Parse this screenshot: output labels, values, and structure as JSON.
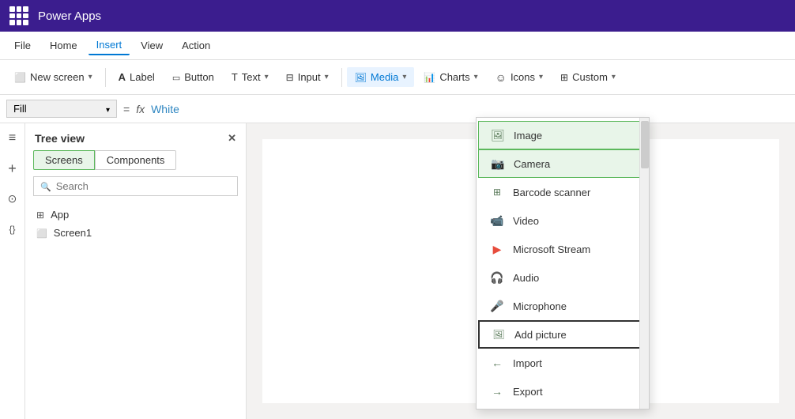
{
  "titleBar": {
    "appName": "Power Apps",
    "gridLabel": "app-grid"
  },
  "menuBar": {
    "items": [
      {
        "id": "file",
        "label": "File",
        "active": false
      },
      {
        "id": "home",
        "label": "Home",
        "active": false
      },
      {
        "id": "insert",
        "label": "Insert",
        "active": true
      },
      {
        "id": "view",
        "label": "View",
        "active": false
      },
      {
        "id": "action",
        "label": "Action",
        "active": false
      }
    ]
  },
  "toolbar": {
    "newScreen": "New screen",
    "label": "Label",
    "button": "Button",
    "text": "Text",
    "input": "Input",
    "media": "Media",
    "charts": "Charts",
    "icons": "Icons",
    "custom": "Custom"
  },
  "formulaBar": {
    "property": "Fill",
    "eq": "=",
    "fx": "fx",
    "value": "White"
  },
  "treeView": {
    "title": "Tree view",
    "tabs": [
      {
        "id": "screens",
        "label": "Screens",
        "active": true
      },
      {
        "id": "components",
        "label": "Components",
        "active": false
      }
    ],
    "searchPlaceholder": "Search",
    "items": [
      {
        "id": "app",
        "label": "App",
        "type": "app"
      },
      {
        "id": "screen1",
        "label": "Screen1",
        "type": "screen"
      }
    ]
  },
  "mediaDropdown": {
    "items": [
      {
        "id": "image",
        "label": "Image",
        "icon": "image",
        "highlighted": true,
        "bordered": false
      },
      {
        "id": "camera",
        "label": "Camera",
        "icon": "camera",
        "highlighted": true,
        "bordered": false
      },
      {
        "id": "barcode",
        "label": "Barcode scanner",
        "icon": "barcode",
        "highlighted": false,
        "bordered": false
      },
      {
        "id": "video",
        "label": "Video",
        "icon": "video",
        "highlighted": false,
        "bordered": false
      },
      {
        "id": "stream",
        "label": "Microsoft Stream",
        "icon": "stream",
        "highlighted": false,
        "bordered": false
      },
      {
        "id": "audio",
        "label": "Audio",
        "icon": "audio",
        "highlighted": false,
        "bordered": false
      },
      {
        "id": "microphone",
        "label": "Microphone",
        "icon": "mic",
        "highlighted": false,
        "bordered": false
      },
      {
        "id": "addpicture",
        "label": "Add picture",
        "icon": "addpic",
        "highlighted": false,
        "bordered": true
      },
      {
        "id": "import",
        "label": "Import",
        "icon": "import",
        "highlighted": false,
        "bordered": false
      },
      {
        "id": "export",
        "label": "Export",
        "icon": "export",
        "highlighted": false,
        "bordered": false
      }
    ]
  }
}
